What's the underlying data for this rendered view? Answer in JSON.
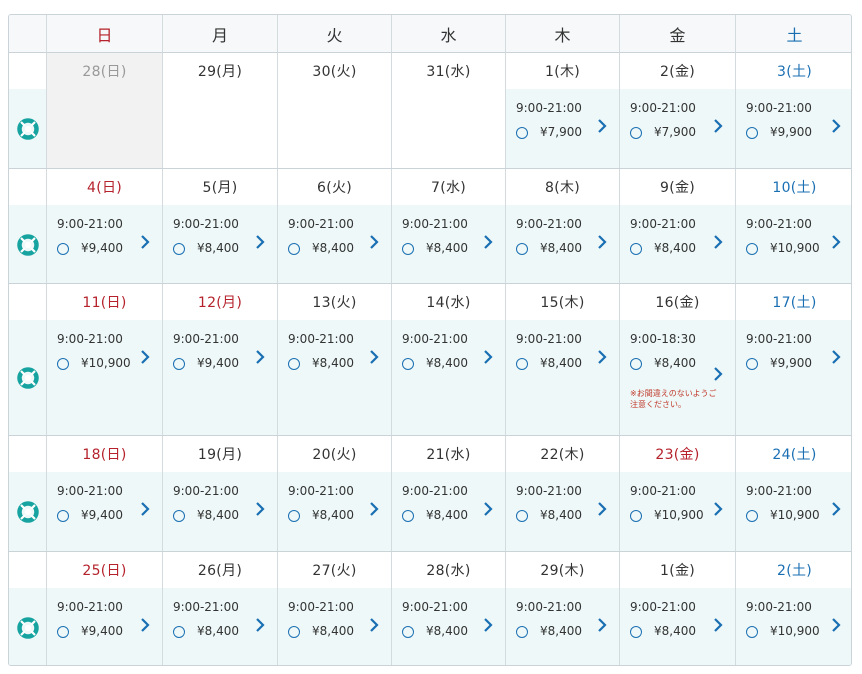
{
  "weekday_headers": [
    {
      "label": "日",
      "kind": "sun"
    },
    {
      "label": "月",
      "kind": ""
    },
    {
      "label": "火",
      "kind": ""
    },
    {
      "label": "水",
      "kind": ""
    },
    {
      "label": "木",
      "kind": ""
    },
    {
      "label": "金",
      "kind": ""
    },
    {
      "label": "土",
      "kind": "sat"
    }
  ],
  "row_icon": "lifebuoy-icon",
  "colors": {
    "accent": "#1a6fb3",
    "holiday": "#b5222c",
    "slot_bg": "#eef8f8",
    "teal": "#17a3a0"
  },
  "weeks": [
    {
      "days": [
        {
          "date": "28(日)",
          "kind": "past",
          "slot": null
        },
        {
          "date": "29(月)",
          "kind": "",
          "slot": null
        },
        {
          "date": "30(火)",
          "kind": "",
          "slot": null
        },
        {
          "date": "31(水)",
          "kind": "",
          "slot": null
        },
        {
          "date": "1(木)",
          "kind": "",
          "slot": {
            "time": "9:00-21:00",
            "status": "○",
            "price": "¥7,900"
          }
        },
        {
          "date": "2(金)",
          "kind": "",
          "slot": {
            "time": "9:00-21:00",
            "status": "○",
            "price": "¥7,900"
          }
        },
        {
          "date": "3(土)",
          "kind": "blue",
          "slot": {
            "time": "9:00-21:00",
            "status": "○",
            "price": "¥9,900"
          }
        }
      ]
    },
    {
      "days": [
        {
          "date": "4(日)",
          "kind": "red",
          "slot": {
            "time": "9:00-21:00",
            "status": "○",
            "price": "¥9,400"
          }
        },
        {
          "date": "5(月)",
          "kind": "",
          "slot": {
            "time": "9:00-21:00",
            "status": "○",
            "price": "¥8,400"
          }
        },
        {
          "date": "6(火)",
          "kind": "",
          "slot": {
            "time": "9:00-21:00",
            "status": "○",
            "price": "¥8,400"
          }
        },
        {
          "date": "7(水)",
          "kind": "",
          "slot": {
            "time": "9:00-21:00",
            "status": "○",
            "price": "¥8,400"
          }
        },
        {
          "date": "8(木)",
          "kind": "",
          "slot": {
            "time": "9:00-21:00",
            "status": "○",
            "price": "¥8,400"
          }
        },
        {
          "date": "9(金)",
          "kind": "",
          "slot": {
            "time": "9:00-21:00",
            "status": "○",
            "price": "¥8,400"
          }
        },
        {
          "date": "10(土)",
          "kind": "blue",
          "slot": {
            "time": "9:00-21:00",
            "status": "○",
            "price": "¥10,900"
          }
        }
      ]
    },
    {
      "days": [
        {
          "date": "11(日)",
          "kind": "red",
          "slot": {
            "time": "9:00-21:00",
            "status": "○",
            "price": "¥10,900"
          }
        },
        {
          "date": "12(月)",
          "kind": "red",
          "slot": {
            "time": "9:00-21:00",
            "status": "○",
            "price": "¥9,400"
          }
        },
        {
          "date": "13(火)",
          "kind": "",
          "slot": {
            "time": "9:00-21:00",
            "status": "○",
            "price": "¥8,400"
          }
        },
        {
          "date": "14(水)",
          "kind": "",
          "slot": {
            "time": "9:00-21:00",
            "status": "○",
            "price": "¥8,400"
          }
        },
        {
          "date": "15(木)",
          "kind": "",
          "slot": {
            "time": "9:00-21:00",
            "status": "○",
            "price": "¥8,400"
          }
        },
        {
          "date": "16(金)",
          "kind": "",
          "slot": {
            "time": "9:00-18:30",
            "status": "○",
            "price": "¥8,400",
            "note": "※お間違えのないようご注意ください。"
          }
        },
        {
          "date": "17(土)",
          "kind": "blue",
          "slot": {
            "time": "9:00-21:00",
            "status": "○",
            "price": "¥9,900"
          }
        }
      ]
    },
    {
      "days": [
        {
          "date": "18(日)",
          "kind": "red",
          "slot": {
            "time": "9:00-21:00",
            "status": "○",
            "price": "¥9,400"
          }
        },
        {
          "date": "19(月)",
          "kind": "",
          "slot": {
            "time": "9:00-21:00",
            "status": "○",
            "price": "¥8,400"
          }
        },
        {
          "date": "20(火)",
          "kind": "",
          "slot": {
            "time": "9:00-21:00",
            "status": "○",
            "price": "¥8,400"
          }
        },
        {
          "date": "21(水)",
          "kind": "",
          "slot": {
            "time": "9:00-21:00",
            "status": "○",
            "price": "¥8,400"
          }
        },
        {
          "date": "22(木)",
          "kind": "",
          "slot": {
            "time": "9:00-21:00",
            "status": "○",
            "price": "¥8,400"
          }
        },
        {
          "date": "23(金)",
          "kind": "red",
          "slot": {
            "time": "9:00-21:00",
            "status": "○",
            "price": "¥10,900"
          }
        },
        {
          "date": "24(土)",
          "kind": "blue",
          "slot": {
            "time": "9:00-21:00",
            "status": "○",
            "price": "¥10,900"
          }
        }
      ]
    },
    {
      "days": [
        {
          "date": "25(日)",
          "kind": "red",
          "slot": {
            "time": "9:00-21:00",
            "status": "○",
            "price": "¥9,400"
          }
        },
        {
          "date": "26(月)",
          "kind": "",
          "slot": {
            "time": "9:00-21:00",
            "status": "○",
            "price": "¥8,400"
          }
        },
        {
          "date": "27(火)",
          "kind": "",
          "slot": {
            "time": "9:00-21:00",
            "status": "○",
            "price": "¥8,400"
          }
        },
        {
          "date": "28(水)",
          "kind": "",
          "slot": {
            "time": "9:00-21:00",
            "status": "○",
            "price": "¥8,400"
          }
        },
        {
          "date": "29(木)",
          "kind": "",
          "slot": {
            "time": "9:00-21:00",
            "status": "○",
            "price": "¥8,400"
          }
        },
        {
          "date": "1(金)",
          "kind": "",
          "slot": {
            "time": "9:00-21:00",
            "status": "○",
            "price": "¥8,400"
          }
        },
        {
          "date": "2(土)",
          "kind": "blue",
          "slot": {
            "time": "9:00-21:00",
            "status": "○",
            "price": "¥10,900"
          }
        }
      ]
    }
  ]
}
